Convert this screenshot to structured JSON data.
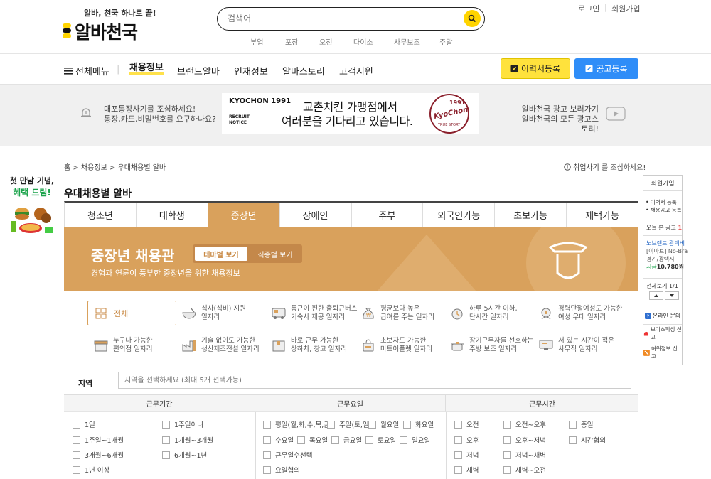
{
  "header": {
    "slogan": "알바, 천국 하나로 끝!",
    "logo_text": "알바천국",
    "search_placeholder": "검색어",
    "keywords": [
      "부업",
      "포장",
      "오전",
      "다이소",
      "사무보조",
      "주말"
    ],
    "login": "로그인",
    "join": "회원가입"
  },
  "gnb": {
    "menu_all": "전체메뉴",
    "items": [
      "채용정보",
      "브랜드알바",
      "인재정보",
      "알바스토리",
      "고객지원"
    ],
    "resume_btn": "이력서등록",
    "post_btn": "공고등록"
  },
  "banner": {
    "left_line1": "대포통장사기를 조심하세요!",
    "left_line2": "통장,카드,비밀번호를 요구하나요?",
    "ad_brand": "KYOCHON 1991",
    "ad_notice1": "RECRUIT",
    "ad_notice2": "NOTICE",
    "ad_line1": "교촌치킨 가맹점에서",
    "ad_line2": "여러분을 기다리고 있습니다.",
    "ad_seal_top": "1991",
    "ad_seal_mid": "KyoChon",
    "ad_seal_bottom": "TRUE STORY",
    "right_line1": "알바천국 광고 보러가기",
    "right_line2": "알바천국의 모든 광고스토리!"
  },
  "promo": {
    "line1": "첫 만남 기념,",
    "line2": "혜택 드림!"
  },
  "breadcrumb": [
    "홈",
    "채용정보",
    "우대채용별 알바"
  ],
  "warning": "취업사기 를 조심하세요!",
  "page_title": "우대채용별 알바",
  "tabs": [
    "청소년",
    "대학생",
    "중장년",
    "장애인",
    "주부",
    "외국인가능",
    "초보가능",
    "재택가능"
  ],
  "active_tab": "중장년",
  "hero": {
    "title": "중장년 채용관",
    "subtitle": "경험과 연륜이 풍부한 중장년을 위한 채용정보",
    "seg_theme": "테마별 보기",
    "seg_job": "직종별 보기"
  },
  "themes": {
    "all": "전체",
    "items": [
      [
        "식사(식비) 지원",
        "일자리"
      ],
      [
        "통근이 편한 출퇴근버스",
        "기숙사 제공 일자리"
      ],
      [
        "평균보다 높은",
        "급여를 주는 일자리"
      ],
      [
        "하루 5시간 이하,",
        "단시간 일자리"
      ],
      [
        "경력단절여성도 가능한",
        "여성 우대 일자리"
      ],
      [
        "누구나 가능한",
        "편의점 일자리"
      ],
      [
        "기술 없이도 가능한",
        "생산제조전설 일자리"
      ],
      [
        "바로 근무 가능한",
        "상하차, 창고 일자리"
      ],
      [
        "초보자도 가능한",
        "마트어플렛 일자리"
      ],
      [
        "장기근무자를 선호하는",
        "주방 보조 일자리"
      ],
      [
        "서 있는 시간이 적은",
        "사무직 일자리"
      ]
    ]
  },
  "filter": {
    "region_label": "지역",
    "region_placeholder": "지역을 선택하세요 (최대 5개 선택가능)",
    "period_head": "근무기간",
    "days_head": "근무요일",
    "time_head": "근무시간",
    "period": [
      "1일",
      "1주일이내",
      "1주일~1개월",
      "1개월~3개월",
      "3개월~6개월",
      "6개월~1년",
      "1년 이상"
    ],
    "days": [
      "평일(월,화,수,목,금)",
      "주말(토,일)",
      "월요일",
      "화요일",
      "수요일",
      "목요일",
      "금요일",
      "토요일",
      "일요일",
      "근무일수선택",
      "요일협의"
    ],
    "times": [
      "오전",
      "오전~오후",
      "종일",
      "오후",
      "오후~저녁",
      "시간협의",
      "저녁",
      "저녁~새벽",
      "새벽",
      "새벽~오전"
    ]
  },
  "sidebar": {
    "join": "회원가입",
    "perk1": "• 이력서 등록",
    "perk2": "• 채용공고 등록",
    "today": "오늘 본 공고",
    "today_count": "1",
    "job_title": "노브랜드 광택비",
    "job_company": "[이마트] No-Bra",
    "job_location": "경기/광택시",
    "job_pay_label": "시급",
    "job_pay": "10,780원",
    "view_all": "전체보기 1/1",
    "inquiry": "온라인 문의",
    "voice": "보이스피싱 신고",
    "false_info": "허위정보 신고"
  },
  "colors": {
    "accent": "#d9a15c",
    "brand_yellow": "#ffe23c",
    "blue": "#2f8df8"
  }
}
